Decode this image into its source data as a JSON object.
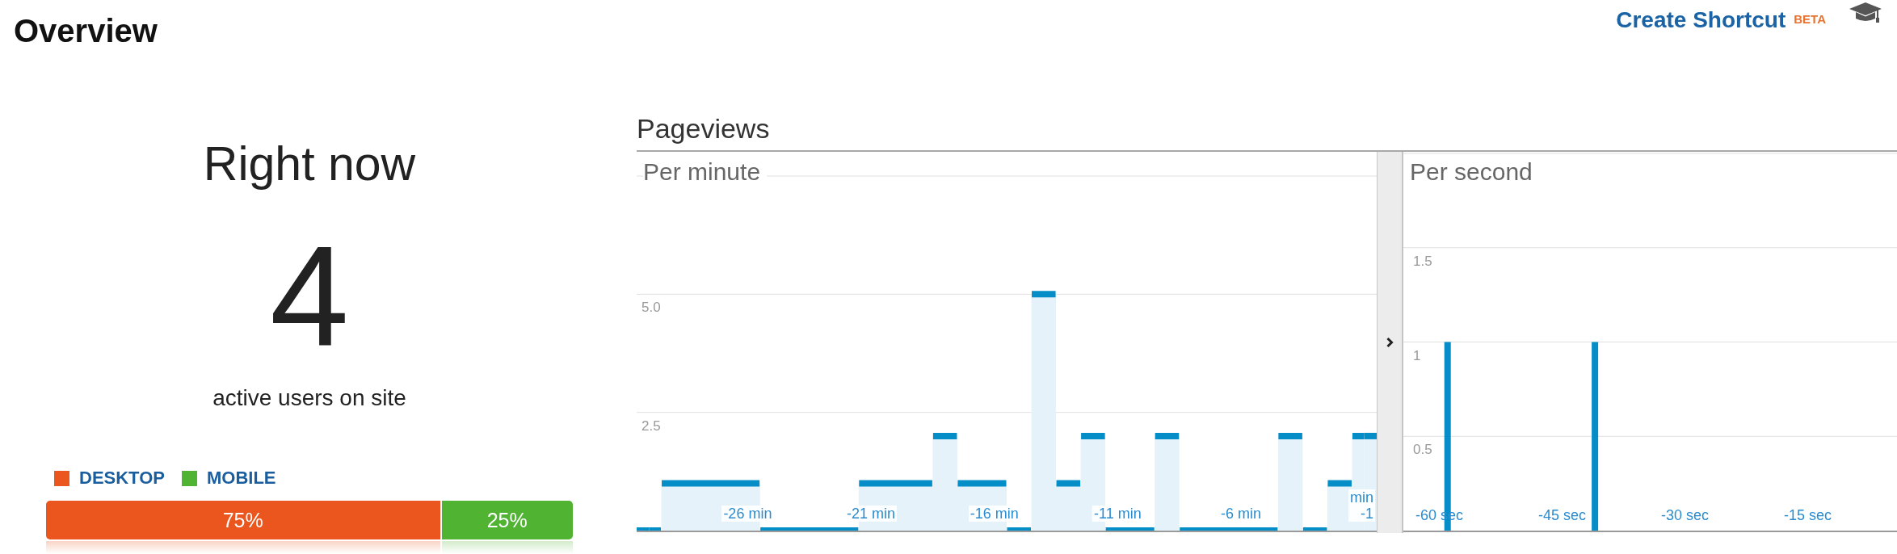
{
  "header": {
    "title": "Overview",
    "shortcut_link": "Create Shortcut",
    "badge": "BETA"
  },
  "right_now": {
    "title": "Right now",
    "count": "4",
    "caption": "active users on site",
    "devices": [
      {
        "label": "DESKTOP",
        "color": "#ea561d",
        "share": "75%",
        "level": 0.75
      },
      {
        "label": "MOBILE",
        "color": "#50b432",
        "share": "25%",
        "level": 0.25
      }
    ]
  },
  "pageviews": {
    "title": "Pageviews",
    "per_minute": {
      "chart_data": {
        "type": "area",
        "title": "Per minute",
        "x": [
          -30,
          -29,
          -28,
          -27,
          -26,
          -25,
          -24,
          -23,
          -22,
          -21,
          -20,
          -19,
          -18,
          -17,
          -16,
          -15,
          -14,
          -13,
          -12,
          -11,
          -10,
          -9,
          -8,
          -7,
          -6,
          -5,
          -4,
          -3,
          -2,
          -1
        ],
        "values": [
          0,
          1,
          1,
          1,
          1,
          0,
          0,
          0,
          0,
          1,
          1,
          1,
          2,
          1,
          1,
          0,
          5,
          1,
          2,
          0,
          0,
          2,
          0,
          0,
          0,
          0,
          2,
          0,
          1,
          2
        ],
        "xlim": [
          -30.5,
          -0.5
        ],
        "ylim": [
          0,
          7.5
        ],
        "yticks": [
          {
            "value": 2.5,
            "label": "2.5"
          },
          {
            "value": 5,
            "label": "5.0"
          }
        ],
        "xticks": [
          {
            "value": -26,
            "label": "-26 min"
          },
          {
            "value": -21,
            "label": "-21 min"
          },
          {
            "value": -16,
            "label": "-16 min"
          },
          {
            "value": -11,
            "label": "-11 min"
          },
          {
            "value": -6,
            "label": "-6 min"
          },
          {
            "value": -1,
            "label": "-1 min"
          }
        ],
        "grid": true
      }
    },
    "per_second": {
      "chart_data": {
        "type": "bar",
        "title": "Per second",
        "x": [
          -59,
          -41
        ],
        "values": [
          1,
          1
        ],
        "xlim": [
          -64.4,
          -4.1
        ],
        "ylim": [
          0,
          2
        ],
        "yticks": [
          0.5,
          1,
          1.5
        ],
        "xticks": [
          {
            "value": -60,
            "label": "-60 sec"
          },
          {
            "value": -45,
            "label": "-45 sec"
          },
          {
            "value": -30,
            "label": "-30 sec"
          },
          {
            "value": -15,
            "label": "-15 sec"
          }
        ],
        "grid": true
      }
    }
  }
}
